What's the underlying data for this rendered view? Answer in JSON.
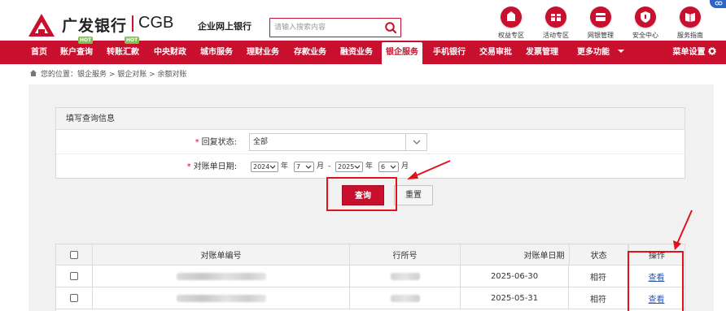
{
  "header": {
    "brand_cn": "广发银行",
    "brand_en": "CGB",
    "subtitle": "企业网上银行",
    "search_placeholder": "请输入搜索内容",
    "quick_links": [
      {
        "label": "权益专区",
        "icon": "gift-icon"
      },
      {
        "label": "活动专区",
        "icon": "present-icon"
      },
      {
        "label": "网银管理",
        "icon": "card-icon"
      },
      {
        "label": "安全中心",
        "icon": "shield-icon"
      },
      {
        "label": "服务指南",
        "icon": "book-icon"
      }
    ]
  },
  "nav": {
    "items": [
      "首页",
      "账户查询",
      "转账汇款",
      "中央财政",
      "城市服务",
      "理财业务",
      "存款业务",
      "融资业务",
      "银企服务",
      "手机银行",
      "交易审批",
      "发票管理",
      "更多功能"
    ],
    "active": "银企服务",
    "hot_badge": "HOT",
    "settings": "菜单设置"
  },
  "breadcrumb": "您的位置：银企服务 > 银企对账 > 余额对账",
  "form": {
    "panel_title": "填写查询信息",
    "reply_status_label": "回复状态:",
    "reply_status_value": "全部",
    "date_label": "对账单日期:",
    "from_year": "2024",
    "from_month": "7",
    "to_year": "2025",
    "to_month": "6",
    "year_unit": "年",
    "month_unit": "月",
    "dash": "-",
    "query_button": "查询",
    "reset_button": "重置"
  },
  "table": {
    "columns": [
      "对账单编号",
      "行所号",
      "对账单日期",
      "状态",
      "操作"
    ],
    "rows": [
      {
        "date": "2025-06-30",
        "status": "相符",
        "action": "查看"
      },
      {
        "date": "2025-05-31",
        "status": "相符",
        "action": "查看"
      }
    ]
  },
  "colors": {
    "brand_red": "#c8102e",
    "annotation_red": "#e0131d",
    "link_blue": "#2b5bb8"
  }
}
